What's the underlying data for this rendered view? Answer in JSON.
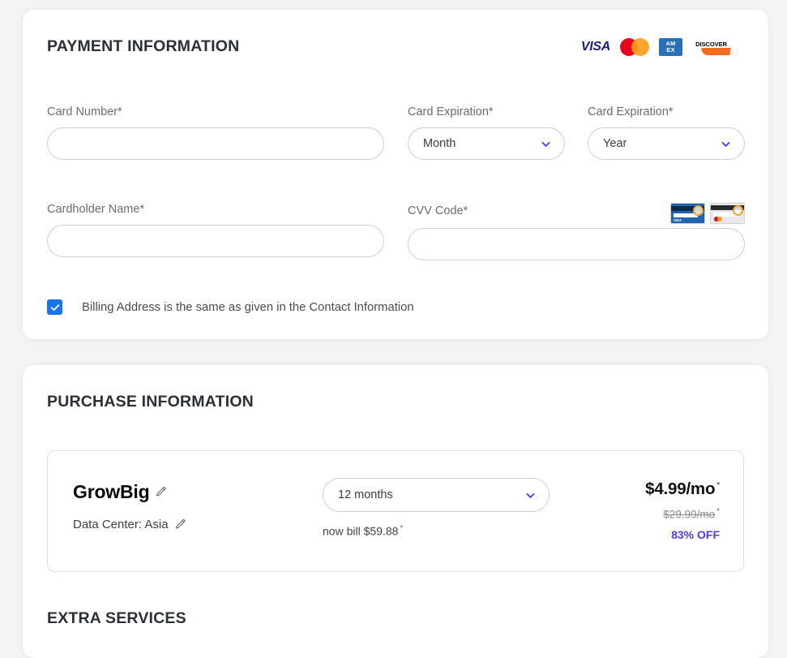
{
  "accent": "#4c3cf0",
  "checkbox_color": "#1a73e8",
  "payment": {
    "title": "PAYMENT INFORMATION",
    "brands": [
      {
        "name": "visa-logo",
        "label": "VISA"
      },
      {
        "name": "mastercard-logo",
        "label": ""
      },
      {
        "name": "amex-logo",
        "label_top": "AM",
        "label_bottom": "EX"
      },
      {
        "name": "discover-logo",
        "label": "DISCOVER"
      }
    ],
    "fields": {
      "card_number": {
        "label": "Card Number*",
        "value": "",
        "placeholder": ""
      },
      "card_expiration_month": {
        "label": "Card Expiration*",
        "value": "Month"
      },
      "card_expiration_year": {
        "label": "Card Expiration*",
        "value": "Year"
      },
      "cardholder_name": {
        "label": "Cardholder Name*",
        "value": "",
        "placeholder": ""
      },
      "cvv_code": {
        "label": "CVV Code*",
        "value": "",
        "placeholder": ""
      }
    },
    "cvv_hint": {
      "visa_card_text": "VISA"
    },
    "billing_checkbox": {
      "label": "Billing Address is the same as given in the Contact Information",
      "checked": true
    }
  },
  "purchase": {
    "title": "PURCHASE INFORMATION",
    "plan": {
      "name": "GrowBig",
      "data_center": "Data Center: Asia",
      "term": "12 months",
      "bill_note": "now bill $59.88",
      "bill_asterisk": "*",
      "price_now": "$4.99/mo",
      "price_now_asterisk": "*",
      "price_old": "$29.99/mo",
      "price_old_asterisk": "*",
      "discount": "83% OFF"
    }
  },
  "extra_services": {
    "title": "EXTRA SERVICES"
  }
}
